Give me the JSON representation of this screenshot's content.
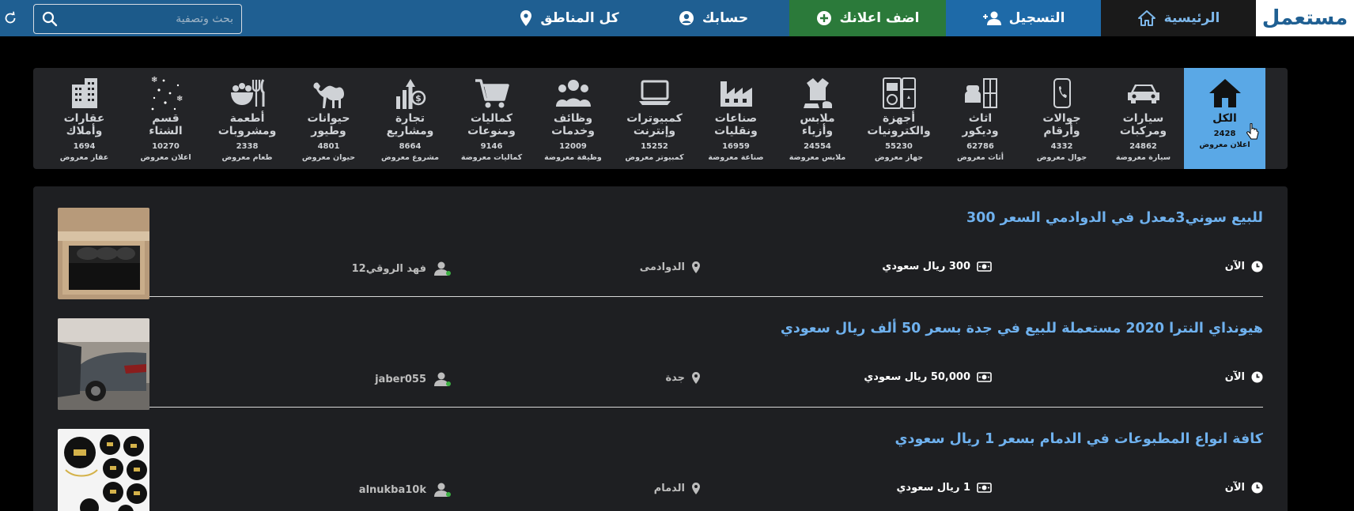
{
  "brand": {
    "logo": "مستعمل"
  },
  "nav": {
    "home": "الرئيسية",
    "register": "التسجيل",
    "add_ad": "اضف اعلانك",
    "account": "حسابك",
    "regions": "كل المناطق"
  },
  "search": {
    "placeholder": "بحث وتصفية",
    "value": ""
  },
  "categories": [
    {
      "name1": "الكل",
      "name2": "",
      "count": "2428",
      "sub": "اعلان معروض",
      "icon": "house-icon",
      "active": true
    },
    {
      "name1": "سيارات",
      "name2": "ومركبات",
      "count": "24862",
      "sub": "سيارة معروضة",
      "icon": "car-icon"
    },
    {
      "name1": "جوالات",
      "name2": "وأرقام",
      "count": "4332",
      "sub": "جوال معروض",
      "icon": "phone-icon"
    },
    {
      "name1": "اثاث",
      "name2": "وديكور",
      "count": "62786",
      "sub": "أثاث معروض",
      "icon": "furniture-icon"
    },
    {
      "name1": "أجهزة",
      "name2": "والكترونيات",
      "count": "55230",
      "sub": "جهاز معروض",
      "icon": "appliance-icon"
    },
    {
      "name1": "ملابس",
      "name2": "وأزياء",
      "count": "24554",
      "sub": "ملابس معروضة",
      "icon": "clothes-icon"
    },
    {
      "name1": "صناعات",
      "name2": "ونقليات",
      "count": "16959",
      "sub": "صناعة معروضة",
      "icon": "factory-icon"
    },
    {
      "name1": "كمبيوترات",
      "name2": "وإنترنت",
      "count": "15252",
      "sub": "كمبيوتر معروض",
      "icon": "laptop-icon"
    },
    {
      "name1": "وظائف",
      "name2": "وخدمات",
      "count": "12009",
      "sub": "وظيفة معروضة",
      "icon": "people-icon"
    },
    {
      "name1": "كماليات",
      "name2": "ومنوعات",
      "count": "9146",
      "sub": "كماليات معروضة",
      "icon": "cart-icon"
    },
    {
      "name1": "تجارة",
      "name2": "ومشاريع",
      "count": "8664",
      "sub": "مشروع معروض",
      "icon": "money-growth-icon"
    },
    {
      "name1": "حيوانات",
      "name2": "وطيور",
      "count": "4801",
      "sub": "حيوان معروض",
      "icon": "camel-icon"
    },
    {
      "name1": "أطعمة",
      "name2": "ومشروبات",
      "count": "2338",
      "sub": "طعام معروض",
      "icon": "food-icon"
    },
    {
      "name1": "قسم",
      "name2": "الشتاء",
      "count": "10270",
      "sub": "اعلان معروض",
      "icon": "snow-icon"
    },
    {
      "name1": "عقارات",
      "name2": "وأملاك",
      "count": "1694",
      "sub": "عقار معروض",
      "icon": "building-icon"
    }
  ],
  "ads": [
    {
      "title": "للبيع سوني3معدل في الدوادمي السعر 300",
      "time": "الآن",
      "price": "300 ريال سعودي",
      "location": "الدوادمى",
      "user": "فهد الروقي12",
      "thumb": "controllers-photo"
    },
    {
      "title": "هيونداي النترا 2020 مستعملة للبيع في جدة بسعر 50 ألف ريال سعودي",
      "time": "الآن",
      "price": "50,000 ريال سعودي",
      "location": "جدة",
      "user": "jaber055",
      "thumb": "car-photo"
    },
    {
      "title": "كافة انواع المطبوعات في الدمام بسعر 1 ريال سعودي",
      "time": "الآن",
      "price": "1 ريال سعودي",
      "location": "الدمام",
      "user": "alnukba10k",
      "thumb": "stickers-photo"
    }
  ],
  "colors": {
    "topbar": "#1f5f92",
    "accent": "#5aa8e6",
    "add": "#2b7a3a",
    "link": "#6fb1ee"
  }
}
